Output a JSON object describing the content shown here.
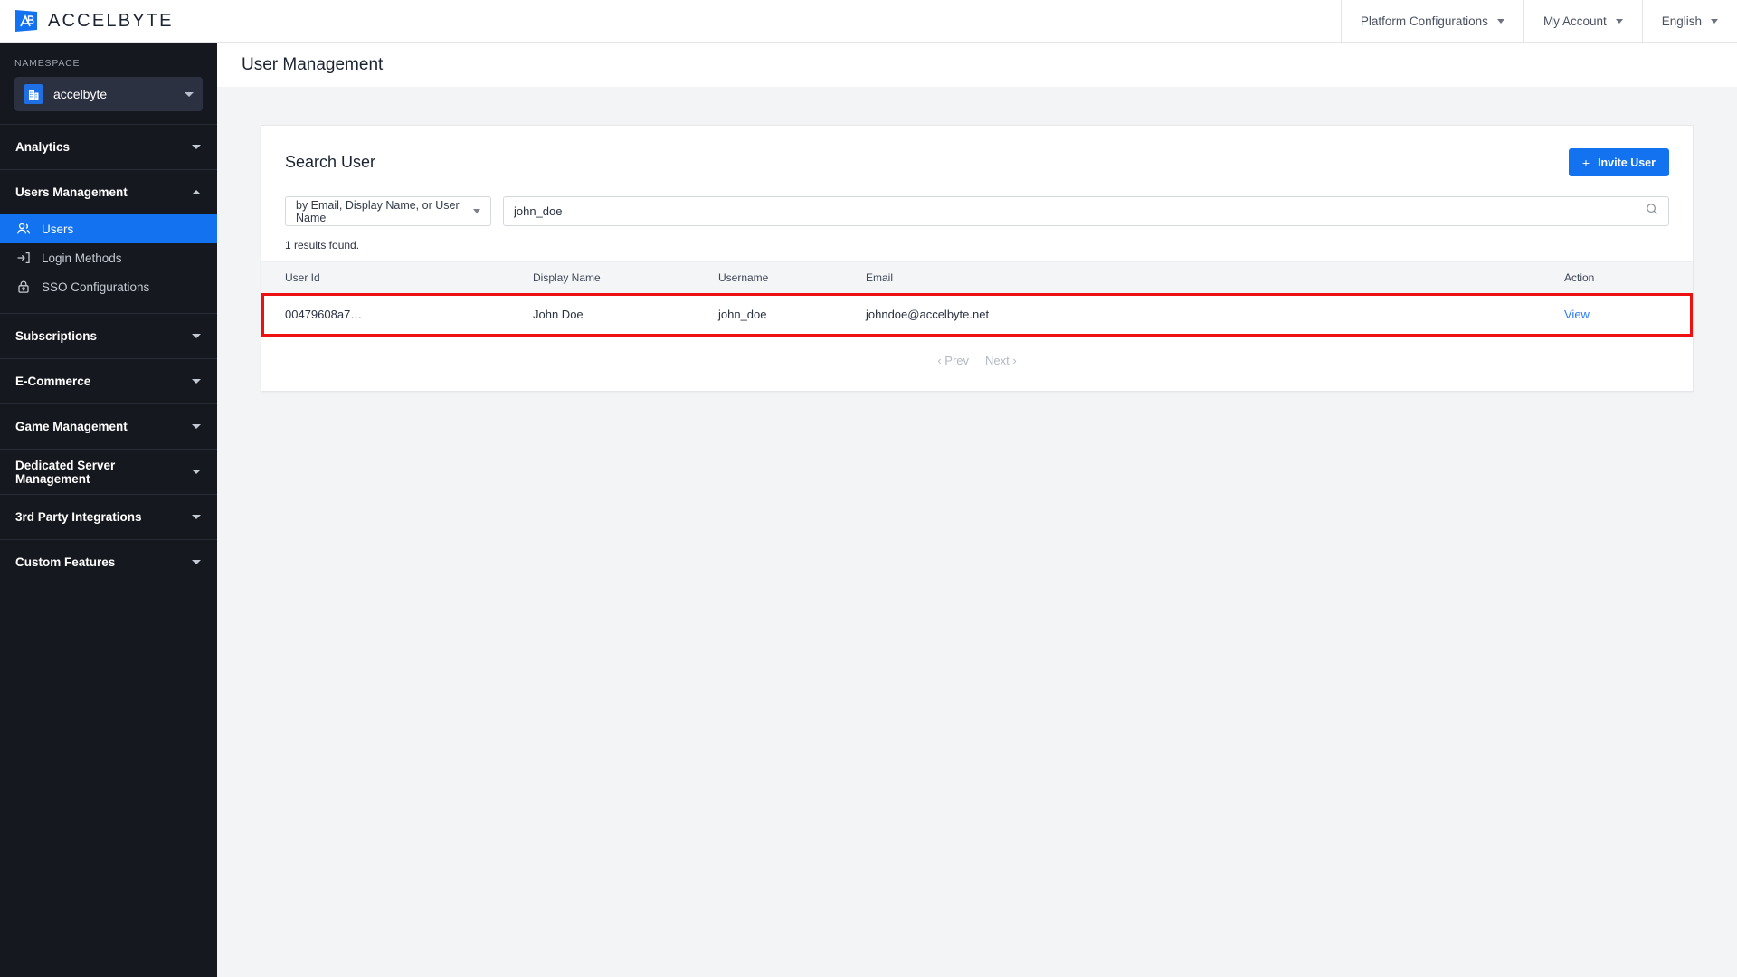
{
  "topbar": {
    "brand_name": "ACCELBYTE",
    "brand_icon": "accelbyte-logo-icon",
    "menu": [
      {
        "label": "Platform Configurations",
        "icon": "chevron-down-icon"
      },
      {
        "label": "My Account",
        "icon": "chevron-down-icon"
      },
      {
        "label": "English",
        "icon": "chevron-down-icon"
      }
    ]
  },
  "sidebar": {
    "namespace_label": "NAMESPACE",
    "namespace_value": "accelbyte",
    "namespace_icon": "building-icon",
    "namespace_chevron": "chevron-down-icon",
    "groups": [
      {
        "label": "Analytics",
        "expanded": false,
        "icon": "triangle-down-icon",
        "items": []
      },
      {
        "label": "Users Management",
        "expanded": true,
        "icon": "triangle-up-icon",
        "items": [
          {
            "label": "Users",
            "icon": "users-icon",
            "active": true
          },
          {
            "label": "Login Methods",
            "icon": "login-arrow-icon",
            "active": false
          },
          {
            "label": "SSO Configurations",
            "icon": "lock-icon",
            "active": false
          }
        ]
      },
      {
        "label": "Subscriptions",
        "expanded": false,
        "icon": "triangle-down-icon",
        "items": []
      },
      {
        "label": "E-Commerce",
        "expanded": false,
        "icon": "triangle-down-icon",
        "items": []
      },
      {
        "label": "Game Management",
        "expanded": false,
        "icon": "triangle-down-icon",
        "items": []
      },
      {
        "label": "Dedicated Server Management",
        "expanded": false,
        "icon": "triangle-down-icon",
        "items": []
      },
      {
        "label": "3rd Party Integrations",
        "expanded": false,
        "icon": "triangle-down-icon",
        "items": []
      },
      {
        "label": "Custom Features",
        "expanded": false,
        "icon": "triangle-down-icon",
        "items": []
      }
    ]
  },
  "page": {
    "title": "User Management"
  },
  "card": {
    "title": "Search User",
    "invite_button": "Invite User",
    "invite_icon": "plus-icon",
    "filter_value": "by Email, Display Name, or User Name",
    "filter_chevron": "chevron-down-icon",
    "search_value": "john_doe",
    "search_placeholder": "",
    "search_icon": "search-icon",
    "results_note": "1 results found."
  },
  "table": {
    "columns": [
      "User Id",
      "Display Name",
      "Username",
      "Email",
      "Action"
    ],
    "rows": [
      {
        "user_id": "00479608a7…",
        "display_name": "John Doe",
        "username": "john_doe",
        "email": "johndoe@accelbyte.net",
        "action": "View",
        "highlighted": true
      }
    ]
  },
  "pagination": {
    "prev": "‹ Prev",
    "next": "Next ›"
  },
  "colors": {
    "accent": "#1272f0",
    "sidebar_bg": "#15181e",
    "page_bg": "#f3f4f6",
    "highlight": "#ee1111",
    "link": "#2b7cf6"
  }
}
